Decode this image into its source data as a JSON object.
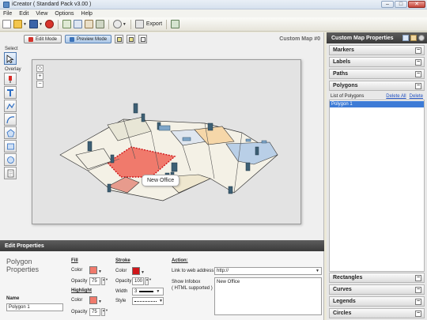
{
  "window": {
    "title": "iCreator ( Standard Pack v3.00 )",
    "minimize": "–",
    "maximize": "□",
    "close": "✕"
  },
  "menu": [
    "File",
    "Edit",
    "View",
    "Options",
    "Help"
  ],
  "toolbar": {
    "export_label": "Export"
  },
  "editor": {
    "edit_mode_label": "Edit Mode",
    "preview_mode_label": "Preview Mode",
    "map_title": "Custom Map #0",
    "select_label": "Select",
    "overlay_label": "Overlay",
    "zoom_in": "+",
    "zoom_out": "−",
    "infobox_text": "New Office"
  },
  "properties": {
    "header": "Edit Properties",
    "title": "Polygon Properties",
    "name_label": "Name",
    "name_value": "Polygon 1",
    "fill": {
      "label": "Fill",
      "color_label": "Color",
      "color": "#f07a6c",
      "opacity_label": "Opacity",
      "opacity": "75"
    },
    "highlight": {
      "label": "Highlight",
      "color_label": "Color",
      "color": "#f07a6c",
      "opacity_label": "Opacity",
      "opacity": "75"
    },
    "stroke": {
      "label": "Stroke",
      "color_label": "Color",
      "color": "#d0161a",
      "opacity_label": "Opacity",
      "opacity": "100",
      "width_label": "Width",
      "width": "3",
      "style_label": "Style"
    },
    "action": {
      "label": "Action:",
      "link_label": "Link to web address",
      "link_value": "http://",
      "infobox_label": "Show Infobox",
      "infobox_sub": "( HTML supported )",
      "infobox_value": "New Office"
    }
  },
  "right_panel": {
    "header": "Custom Map Properties",
    "sections_top": [
      "Markers",
      "Labels",
      "Paths",
      "Polygons"
    ],
    "list_label": "List of Polygons",
    "delete_all": "Delete All",
    "delete": "Delete",
    "polygons": [
      "Polygon 1"
    ],
    "sections_bottom": [
      "Rectangles",
      "Curves",
      "Legends",
      "Circles"
    ],
    "toggle_symbol": "−"
  }
}
